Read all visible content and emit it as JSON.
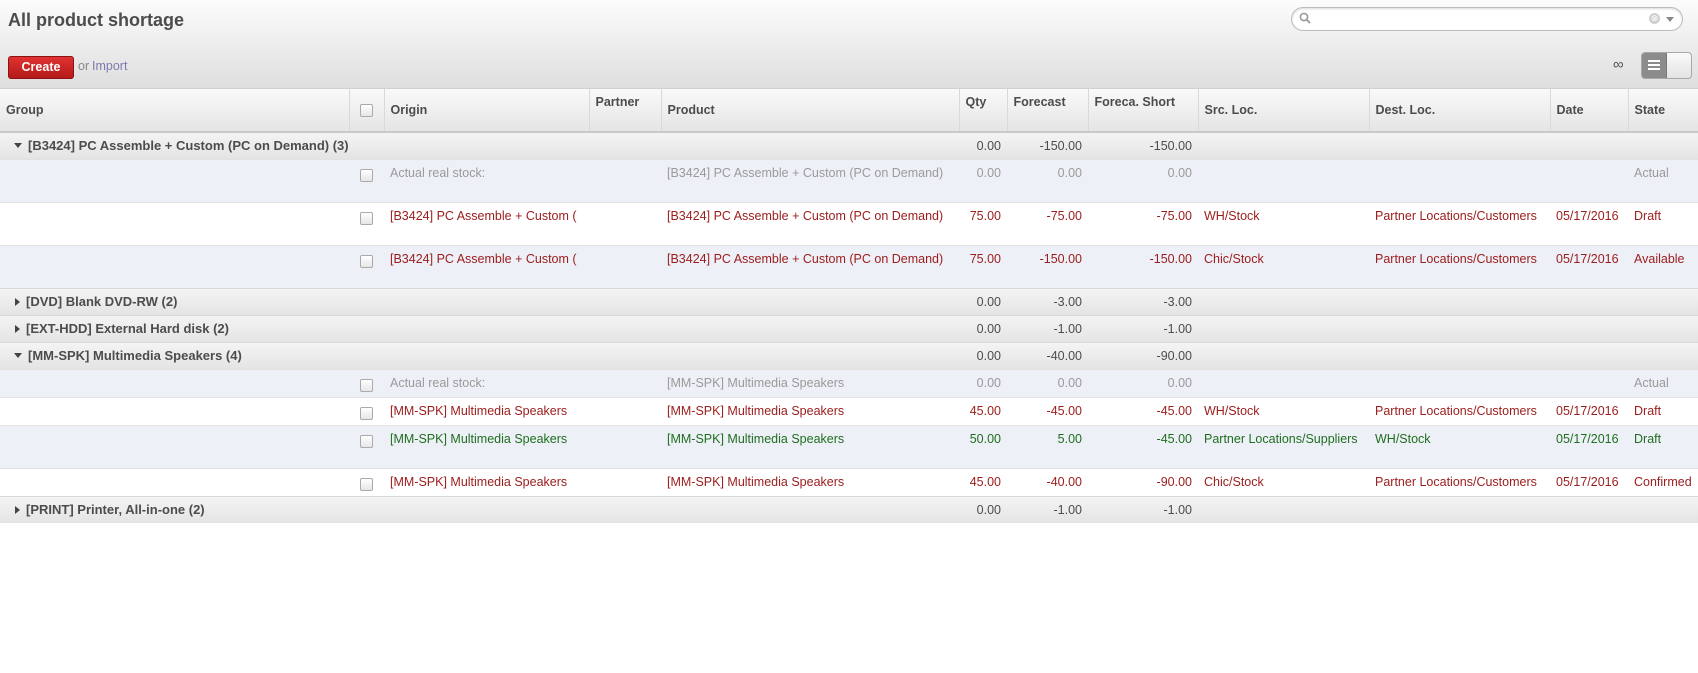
{
  "page": {
    "title": "All product shortage"
  },
  "search": {
    "placeholder": "",
    "clear_label": "⊗"
  },
  "toolbar": {
    "create_label": "Create",
    "or_label": "or",
    "import_label": "Import",
    "limit_label": "∞"
  },
  "columns": {
    "group": "Group",
    "origin": "Origin",
    "partner": "Partner",
    "product": "Product",
    "qty": "Qty",
    "forecast": "Forecast",
    "forecast_short": "Foreca. Short",
    "src_loc": "Src. Loc.",
    "dest_loc": "Dest. Loc.",
    "date": "Date",
    "state": "State"
  },
  "groups": [
    {
      "name": "[B3424] PC Assemble + Custom (PC on Demand) (3)",
      "expanded": true,
      "qty": "0.00",
      "forecast": "-150.00",
      "forecast_short": "-150.00",
      "rows": [
        {
          "origin": "Actual real stock:",
          "partner": "",
          "product": "[B3424] PC Assemble + Custom (PC on Demand)",
          "qty": "0.00",
          "forecast": "0.00",
          "forecast_short": "0.00",
          "src": "",
          "dest": "",
          "date": "",
          "state": "Actual",
          "color": "gray"
        },
        {
          "origin": "[B3424] PC Assemble + Custom (",
          "partner": "",
          "product": "[B3424] PC Assemble + Custom (PC on Demand)",
          "qty": "75.00",
          "forecast": "-75.00",
          "forecast_short": "-75.00",
          "src": "WH/Stock",
          "dest": "Partner Locations/Customers",
          "date": "05/17/2016",
          "state": "Draft",
          "color": "red"
        },
        {
          "origin": "[B3424] PC Assemble + Custom (",
          "partner": "",
          "product": "[B3424] PC Assemble + Custom (PC on Demand)",
          "qty": "75.00",
          "forecast": "-150.00",
          "forecast_short": "-150.00",
          "src": "Chic/Stock",
          "dest": "Partner Locations/Customers",
          "date": "05/17/2016",
          "state": "Available",
          "color": "red"
        }
      ]
    },
    {
      "name": "[DVD] Blank DVD-RW (2)",
      "expanded": false,
      "qty": "0.00",
      "forecast": "-3.00",
      "forecast_short": "-3.00",
      "rows": []
    },
    {
      "name": "[EXT-HDD] External Hard disk (2)",
      "expanded": false,
      "qty": "0.00",
      "forecast": "-1.00",
      "forecast_short": "-1.00",
      "rows": []
    },
    {
      "name": "[MM-SPK] Multimedia Speakers (4)",
      "expanded": true,
      "qty": "0.00",
      "forecast": "-40.00",
      "forecast_short": "-90.00",
      "rows": [
        {
          "origin": "Actual real stock:",
          "partner": "",
          "product": "[MM-SPK] Multimedia Speakers",
          "qty": "0.00",
          "forecast": "0.00",
          "forecast_short": "0.00",
          "src": "",
          "dest": "",
          "date": "",
          "state": "Actual",
          "color": "gray"
        },
        {
          "origin": "[MM-SPK] Multimedia Speakers",
          "partner": "",
          "product": "[MM-SPK] Multimedia Speakers",
          "qty": "45.00",
          "forecast": "-45.00",
          "forecast_short": "-45.00",
          "src": "WH/Stock",
          "dest": "Partner Locations/Customers",
          "date": "05/17/2016",
          "state": "Draft",
          "color": "red"
        },
        {
          "origin": "[MM-SPK] Multimedia Speakers",
          "partner": "",
          "product": "[MM-SPK] Multimedia Speakers",
          "qty": "50.00",
          "forecast": "5.00",
          "forecast_short": "-45.00",
          "src": "Partner Locations/Suppliers",
          "dest": "WH/Stock",
          "date": "05/17/2016",
          "state": "Draft",
          "color": "green"
        },
        {
          "origin": "[MM-SPK] Multimedia Speakers",
          "partner": "",
          "product": "[MM-SPK] Multimedia Speakers",
          "qty": "45.00",
          "forecast": "-40.00",
          "forecast_short": "-90.00",
          "src": "Chic/Stock",
          "dest": "Partner Locations/Customers",
          "date": "05/17/2016",
          "state": "Confirmed",
          "color": "red"
        }
      ]
    },
    {
      "name": "[PRINT] Printer, All-in-one (2)",
      "expanded": false,
      "qty": "0.00",
      "forecast": "-1.00",
      "forecast_short": "-1.00",
      "rows": []
    }
  ]
}
